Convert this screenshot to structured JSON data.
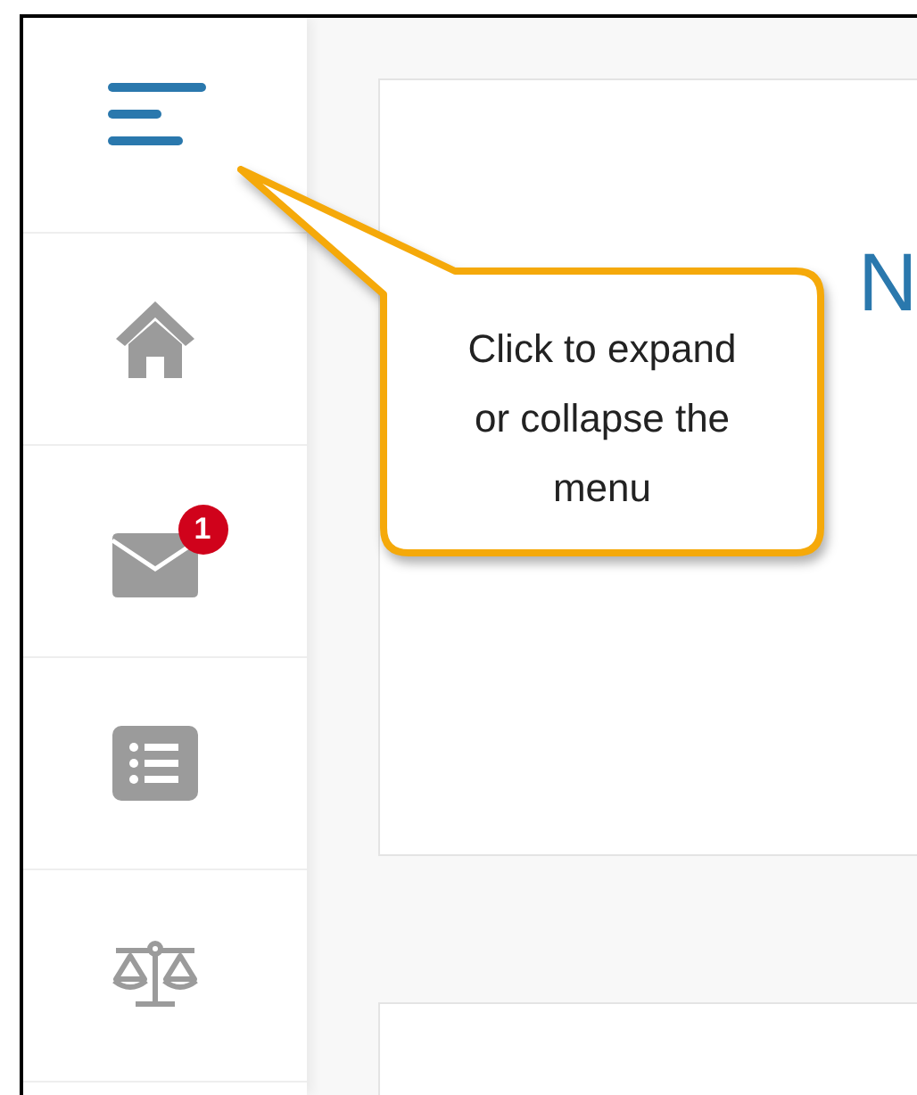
{
  "sidebar": {
    "items": [
      {
        "kind": "home"
      },
      {
        "kind": "mail",
        "badge": "1"
      },
      {
        "kind": "list"
      },
      {
        "kind": "scales"
      }
    ]
  },
  "card": {
    "title": "N"
  },
  "callout": {
    "lines": [
      "Click to expand",
      "or collapse the",
      "menu"
    ]
  }
}
